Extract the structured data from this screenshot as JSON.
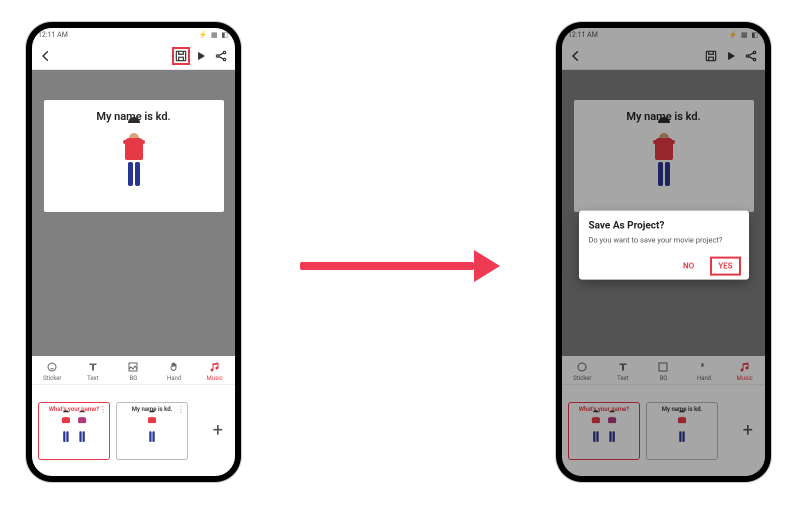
{
  "status": {
    "time": "12:11 AM",
    "carrier": "",
    "icons": "⚡ ▦ ◧"
  },
  "appbar": {
    "back_icon": "back",
    "save_icon": "save-project",
    "play_icon": "play",
    "share_icon": "share"
  },
  "slide": {
    "title": "My name is kd."
  },
  "tools": [
    {
      "label": "Sticker"
    },
    {
      "label": "Text"
    },
    {
      "label": "BG"
    },
    {
      "label": "Hand"
    },
    {
      "label": "Music"
    }
  ],
  "thumbs": [
    {
      "title": "What's your name?"
    },
    {
      "title": "My name is kd."
    }
  ],
  "add_label": "+",
  "dialog": {
    "title": "Save As Project?",
    "body": "Do you want to save your movie project?",
    "no": "NO",
    "yes": "YES"
  }
}
